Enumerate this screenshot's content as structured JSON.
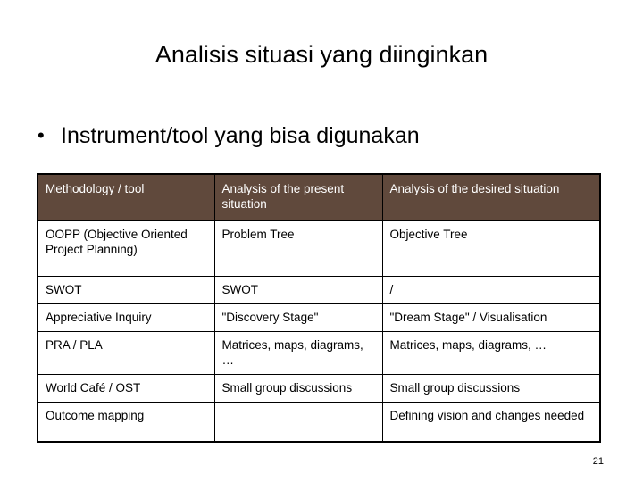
{
  "slide": {
    "title": "Analisis situasi yang diinginkan",
    "page_number": "21",
    "background_color": "#ffffff"
  },
  "body": {
    "bullets": [
      {
        "marker": "•",
        "text": "Instrument/tool yang bisa digunakan"
      }
    ]
  },
  "table": {
    "header_background_color": "#60493C",
    "header_text_color": "#ffffff",
    "border_color": "#000000",
    "columns": [
      "Methodology / tool",
      "Analysis of the present situation",
      "Analysis of the desired situation"
    ],
    "rows": [
      {
        "tool": "OOPP (Objective Oriented Project Planning)",
        "present": "Problem Tree",
        "desired": "Objective Tree"
      },
      {
        "tool": "SWOT",
        "present": "SWOT",
        "desired": "/"
      },
      {
        "tool": "Appreciative Inquiry",
        "present": "\"Discovery Stage\"",
        "desired": "\"Dream Stage\" / Visualisation"
      },
      {
        "tool": "PRA / PLA",
        "present": "Matrices, maps, diagrams, …",
        "desired": "Matrices, maps, diagrams, …"
      },
      {
        "tool": "World Café / OST",
        "present": "Small group discussions",
        "desired": "Small group discussions"
      },
      {
        "tool": "Outcome mapping",
        "present": "",
        "desired": "Defining vision and changes needed"
      }
    ]
  }
}
